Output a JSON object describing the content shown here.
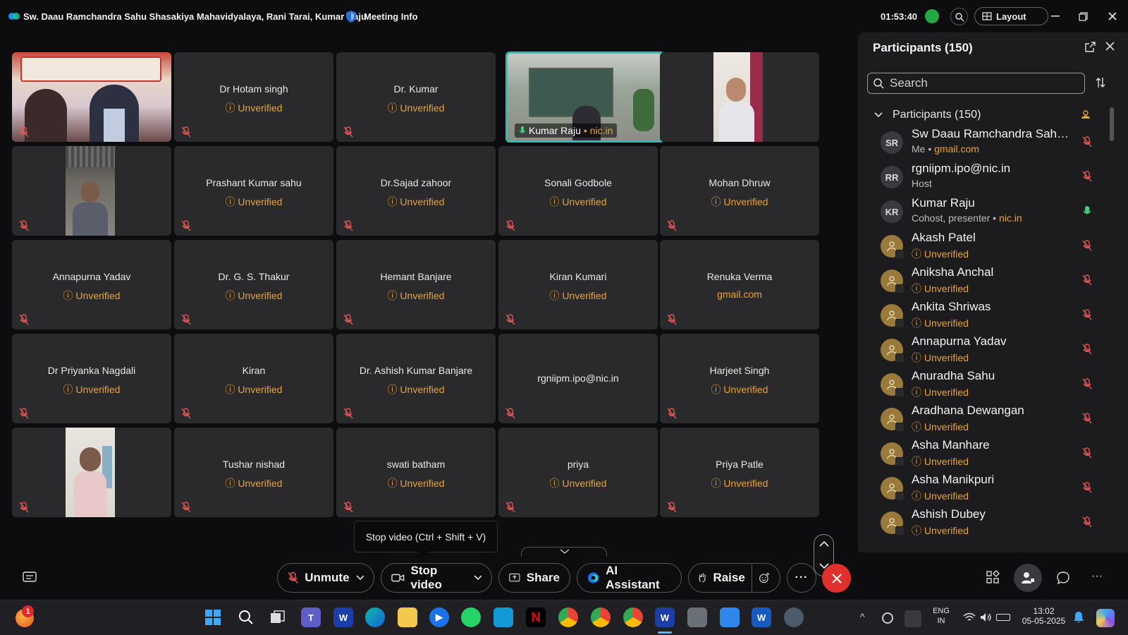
{
  "titlebar": {
    "title": "Sw. Daau Ramchandra Sahu Shasakiya Mahavidyalaya, Rani Tarai, Kumar Raju",
    "meeting_info": "Meeting Info",
    "time": "01:53:40",
    "layout": "Layout"
  },
  "tiles": [
    {
      "name": "",
      "status": ""
    },
    {
      "name": "Dr Hotam singh",
      "status": "Unverified"
    },
    {
      "name": "Dr. Kumar",
      "status": "Unverified"
    },
    {
      "name": "Kumar Raju",
      "status": "nic.in"
    },
    {
      "name": "",
      "status": ""
    },
    {
      "name": "",
      "status": ""
    },
    {
      "name": "Prashant Kumar sahu",
      "status": "Unverified"
    },
    {
      "name": "Dr.Sajad zahoor",
      "status": "Unverified"
    },
    {
      "name": "Sonali Godbole",
      "status": "Unverified"
    },
    {
      "name": "Mohan Dhruw",
      "status": "Unverified"
    },
    {
      "name": "Annapurna Yadav",
      "status": "Unverified"
    },
    {
      "name": "Dr. G. S. Thakur",
      "status": "Unverified"
    },
    {
      "name": "Hemant Banjare",
      "status": "Unverified"
    },
    {
      "name": "Kiran Kumari",
      "status": "Unverified"
    },
    {
      "name": "Renuka Verma",
      "status": "gmail.com"
    },
    {
      "name": "Dr Priyanka Nagdali",
      "status": "Unverified"
    },
    {
      "name": "Kiran",
      "status": "Unverified"
    },
    {
      "name": "Dr. Ashish Kumar Banjare",
      "status": "Unverified"
    },
    {
      "name": "rgniipm.ipo@nic.in",
      "status": ""
    },
    {
      "name": "Harjeet Singh",
      "status": "Unverified"
    },
    {
      "name": "",
      "status": ""
    },
    {
      "name": "Tushar nishad",
      "status": "Unverified"
    },
    {
      "name": "swati batham",
      "status": "Unverified"
    },
    {
      "name": "priya",
      "status": "Unverified"
    },
    {
      "name": "Priya Patle",
      "status": "Unverified"
    }
  ],
  "tooltip": "Stop video (Ctrl + Shift + V)",
  "controls": {
    "unmute": "Unmute",
    "stop_video": "Stop video",
    "share": "Share",
    "ai": "AI Assistant",
    "raise": "Raise"
  },
  "panel": {
    "title": "Participants (150)",
    "search_placeholder": "Search",
    "group": "Participants (150)",
    "people": [
      {
        "initials": "SR",
        "name": "Sw Daau Ramchandra Sahu ...",
        "sub": "Me",
        "dom": "gmail.com"
      },
      {
        "initials": "RR",
        "name": "rgniipm.ipo@nic.in",
        "sub": "Host",
        "dom": ""
      },
      {
        "initials": "KR",
        "name": "Kumar Raju",
        "sub": "Cohost, presenter",
        "dom": "nic.in"
      },
      {
        "initials": "",
        "name": "Akash Patel",
        "sub": "Unverified",
        "dom": ""
      },
      {
        "initials": "",
        "name": "Aniksha Anchal",
        "sub": "Unverified",
        "dom": ""
      },
      {
        "initials": "",
        "name": "Ankita Shriwas",
        "sub": "Unverified",
        "dom": ""
      },
      {
        "initials": "",
        "name": "Annapurna Yadav",
        "sub": "Unverified",
        "dom": ""
      },
      {
        "initials": "",
        "name": "Anuradha Sahu",
        "sub": "Unverified",
        "dom": ""
      },
      {
        "initials": "",
        "name": "Aradhana Dewangan",
        "sub": "Unverified",
        "dom": ""
      },
      {
        "initials": "",
        "name": "Asha Manhare",
        "sub": "Unverified",
        "dom": ""
      },
      {
        "initials": "",
        "name": "Asha Manikpuri",
        "sub": "Unverified",
        "dom": ""
      },
      {
        "initials": "",
        "name": "Ashish Dubey",
        "sub": "Unverified",
        "dom": ""
      }
    ]
  },
  "taskbar": {
    "badge": "1",
    "lang1": "ENG",
    "lang2": "IN",
    "clock": "13:02",
    "date": "05-05-2025"
  },
  "colors": {
    "accent_orange": "#e8a33b",
    "end_red": "#e0302c",
    "active_border": "#2bbfae",
    "mic_muted": "#e05555"
  }
}
